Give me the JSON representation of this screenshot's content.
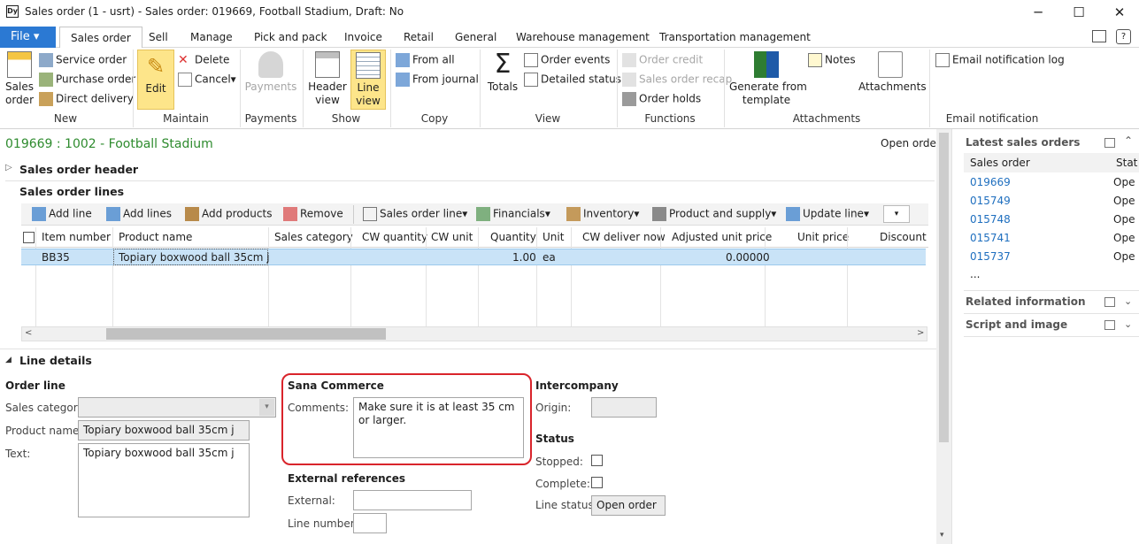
{
  "window": {
    "title": "Sales order (1 - usrt) - Sales order: 019669, Football Stadium, Draft: No",
    "app_icon": "Dy",
    "minimize": "─",
    "maximize": "☐",
    "close": "✕"
  },
  "tabs": {
    "file": "File",
    "file_arrow": "▾",
    "items": [
      "Sales order",
      "Sell",
      "Manage",
      "Pick and pack",
      "Invoice",
      "Retail",
      "General",
      "Warehouse management",
      "Transportation management"
    ]
  },
  "ribbon": {
    "new": {
      "label": "New",
      "sales_order": "Sales\norder",
      "service_order": "Service order",
      "purchase_order": "Purchase order",
      "direct_delivery": "Direct delivery"
    },
    "maintain": {
      "label": "Maintain",
      "edit": "Edit",
      "delete": "Delete",
      "cancel": "Cancel"
    },
    "payments": {
      "label": "Payments",
      "payments": "Payments"
    },
    "show": {
      "label": "Show",
      "header_view": "Header\nview",
      "line_view": "Line\nview"
    },
    "copy": {
      "label": "Copy",
      "from_all": "From all",
      "from_journal": "From journal"
    },
    "view": {
      "label": "View",
      "totals": "Totals",
      "order_events": "Order events",
      "detailed_status": "Detailed status"
    },
    "functions": {
      "label": "Functions",
      "order_credit": "Order credit",
      "sales_order_recap": "Sales order recap",
      "order_holds": "Order holds"
    },
    "attachments": {
      "label": "Attachments",
      "generate_from_template": "Generate from\ntemplate",
      "notes": "Notes",
      "attachments": "Attachments"
    },
    "email_notification": {
      "label": "Email notification",
      "email_log": "Email notification log"
    }
  },
  "page": {
    "headline": "019669 : 1002 - Football Stadium",
    "open_order": "Open order",
    "header_section": "Sales order header",
    "lines_section": "Sales order lines"
  },
  "lines_toolbar": [
    "Add line",
    "Add lines",
    "Add products",
    "Remove",
    "Sales order line",
    "Financials",
    "Inventory",
    "Product and supply",
    "Update line"
  ],
  "grid": {
    "columns": [
      "Item number",
      "Product name",
      "Sales category",
      "CW quantity",
      "CW unit",
      "Quantity",
      "Unit",
      "CW deliver now",
      "Adjusted unit price",
      "Unit price",
      "Discount"
    ],
    "rows": [
      {
        "item_number": "BB35",
        "product_name": "Topiary boxwood ball 35cm j",
        "sales_category": "",
        "cw_quantity": "",
        "cw_unit": "",
        "quantity": "1.00",
        "unit": "ea",
        "cw_deliver_now": "",
        "adjusted_unit_price": "0.00000",
        "unit_price": "",
        "discount": ""
      }
    ]
  },
  "line_details": {
    "title": "Line details",
    "order_line": {
      "title": "Order line",
      "sales_category_label": "Sales category:",
      "product_name_label": "Product name:",
      "product_name": "Topiary boxwood ball 35cm j",
      "text_label": "Text:",
      "text": "Topiary boxwood ball 35cm j"
    },
    "sana": {
      "title": "Sana Commerce",
      "comments_label": "Comments:",
      "comments": "Make sure it is at least 35 cm or larger.",
      "highlight_color": "#d9242b"
    },
    "external": {
      "title": "External references",
      "external_label": "External:",
      "external": "",
      "line_number_label": "Line number:",
      "line_number": ""
    },
    "intercompany": {
      "title": "Intercompany",
      "origin_label": "Origin:",
      "origin": ""
    },
    "status": {
      "title": "Status",
      "stopped_label": "Stopped:",
      "complete_label": "Complete:",
      "line_status_label": "Line status:",
      "line_status": "Open order"
    }
  },
  "right_pane": {
    "latest_title": "Latest sales orders",
    "col_sales_order": "Sales order",
    "col_status": "Stat",
    "orders": [
      {
        "id": "019669",
        "status": "Ope"
      },
      {
        "id": "015749",
        "status": "Ope"
      },
      {
        "id": "015748",
        "status": "Ope"
      },
      {
        "id": "015741",
        "status": "Ope"
      },
      {
        "id": "015737",
        "status": "Ope"
      }
    ],
    "more": "...",
    "related": "Related information",
    "script": "Script and image"
  }
}
